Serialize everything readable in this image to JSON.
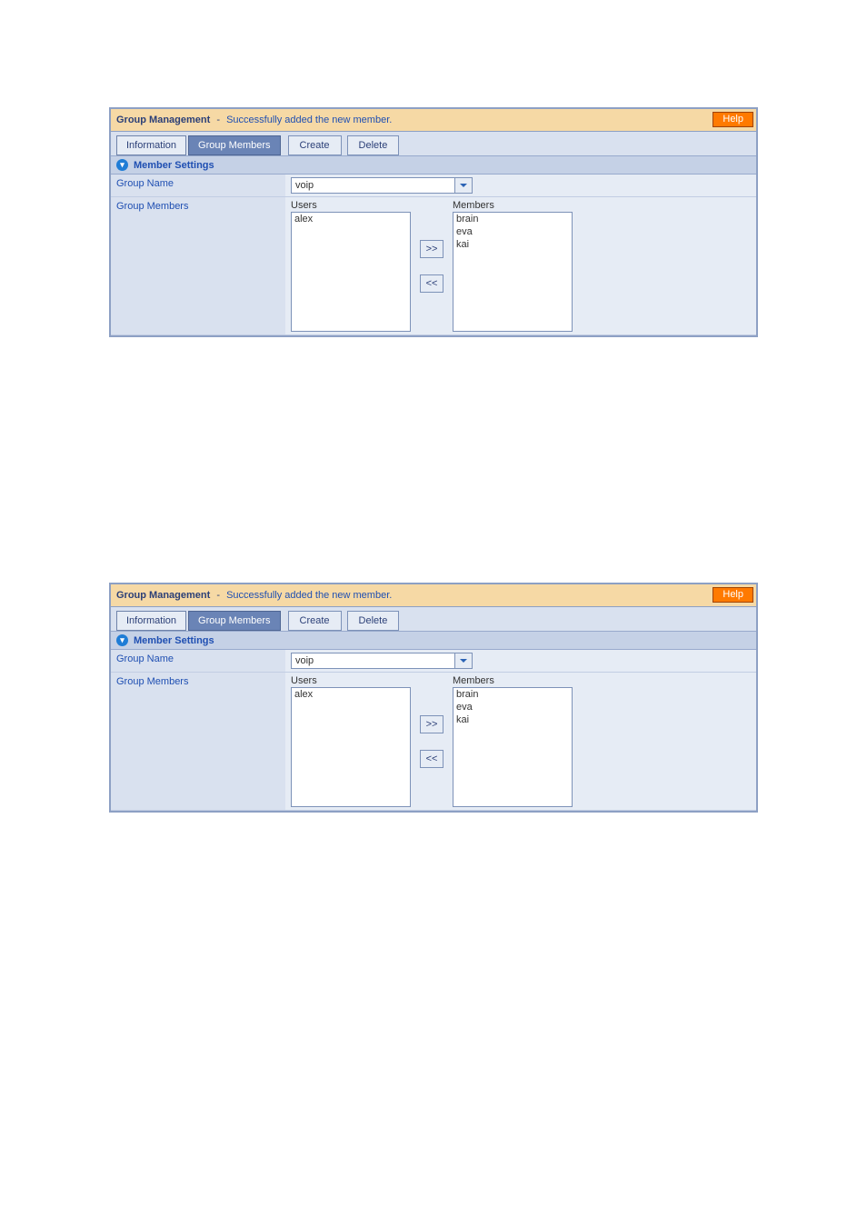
{
  "header": {
    "title": "Group Management",
    "separator": "-",
    "status_msg": "Successfully added the new member.",
    "help_label": "Help"
  },
  "tabs": {
    "information": "Information",
    "group_members": "Group Members"
  },
  "actions": {
    "create": "Create",
    "delete": "Delete"
  },
  "section": {
    "title": "Member Settings"
  },
  "form": {
    "group_name_label": "Group Name",
    "group_name_value": "voip",
    "group_members_label": "Group Members",
    "users_caption": "Users",
    "members_caption": "Members",
    "users": [
      "alex"
    ],
    "members": [
      "brain",
      "eva",
      "kai"
    ],
    "move_right": ">>",
    "move_left": "<<"
  }
}
